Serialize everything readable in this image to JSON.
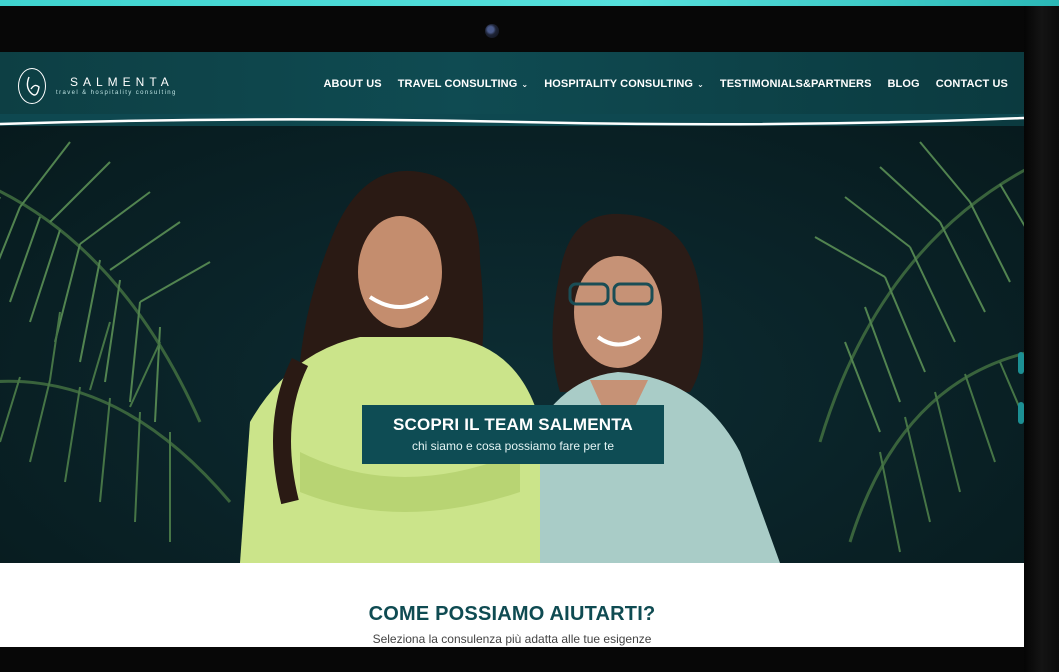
{
  "header": {
    "logo_name": "SALMENTA",
    "logo_tagline": "travel & hospitality consulting",
    "nav": [
      {
        "label": "ABOUT US",
        "dropdown": false
      },
      {
        "label": "TRAVEL CONSULTING",
        "dropdown": true
      },
      {
        "label": "HOSPITALITY CONSULTING",
        "dropdown": true
      },
      {
        "label": "TESTIMONIALS&PARTNERS",
        "dropdown": false
      },
      {
        "label": "BLOG",
        "dropdown": false
      },
      {
        "label": "CONTACT US",
        "dropdown": false
      }
    ]
  },
  "hero": {
    "cta_title": "SCOPRI IL TEAM SALMENTA",
    "cta_subtitle": "chi siamo e cosa possiamo fare per te"
  },
  "help_section": {
    "title": "COME POSSIAMO AIUTARTI?",
    "subtitle": "Seleziona la consulenza più adatta alle tue esigenze"
  },
  "colors": {
    "brand_teal": "#0f4b52",
    "device_accent": "#3fd3cf",
    "cta_background": "#0e4c54"
  },
  "icons": {
    "dropdown": "chevron-down-icon",
    "logo": "salmenta-logo-mark"
  }
}
